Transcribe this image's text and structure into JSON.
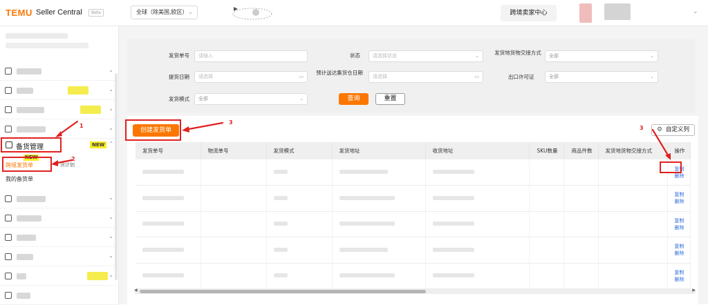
{
  "header": {
    "logo": "TEMU",
    "app_title": "Seller Central",
    "badge": "Beta",
    "region_selector": "全球（除美国,欧区）",
    "cross_border_center": "跨境卖家中心"
  },
  "sidebar": {
    "active_menu": "备货管理",
    "active_menu_badge": "NEW",
    "sub_items": [
      {
        "label": "跨境发货单",
        "badge": "NEW",
        "active": true
      },
      {
        "label": "货计划",
        "active": false
      },
      {
        "label": "我的备货单",
        "active": false
      }
    ]
  },
  "filters": {
    "shipment_no": {
      "label": "发货单号",
      "placeholder": "请输入"
    },
    "status": {
      "label": "状态",
      "placeholder": "请选择状态"
    },
    "handover_method": {
      "label": "发货地货物交接方式",
      "value": "全部"
    },
    "ship_date": {
      "label": "提货日期",
      "placeholder": "请选择"
    },
    "expected_arrival": {
      "label": "预计送达集货仓日期",
      "placeholder": "请选择"
    },
    "export_license": {
      "label": "出口许可证",
      "value": "全部"
    },
    "ship_mode": {
      "label": "发货模式",
      "value": "全部"
    },
    "query_button": "查询",
    "reset_button": "重置"
  },
  "toolbar": {
    "create_button": "创建发货单",
    "custom_columns_button": "自定义列"
  },
  "table": {
    "columns": [
      "发货单号",
      "物流单号",
      "发货模式",
      "发货地址",
      "收货地址",
      "SKU数量",
      "商品件数",
      "发货地货物交接方式",
      "操作"
    ],
    "row_actions": [
      "复制",
      "删除"
    ]
  },
  "annotations": {
    "step1": "1",
    "step2": "2",
    "step3_create": "3",
    "step3_copy": "3"
  },
  "colors": {
    "brand": "#fb7701",
    "annotation": "#e02020",
    "link": "#2f6de1",
    "new_badge": "#f7ec2a"
  }
}
